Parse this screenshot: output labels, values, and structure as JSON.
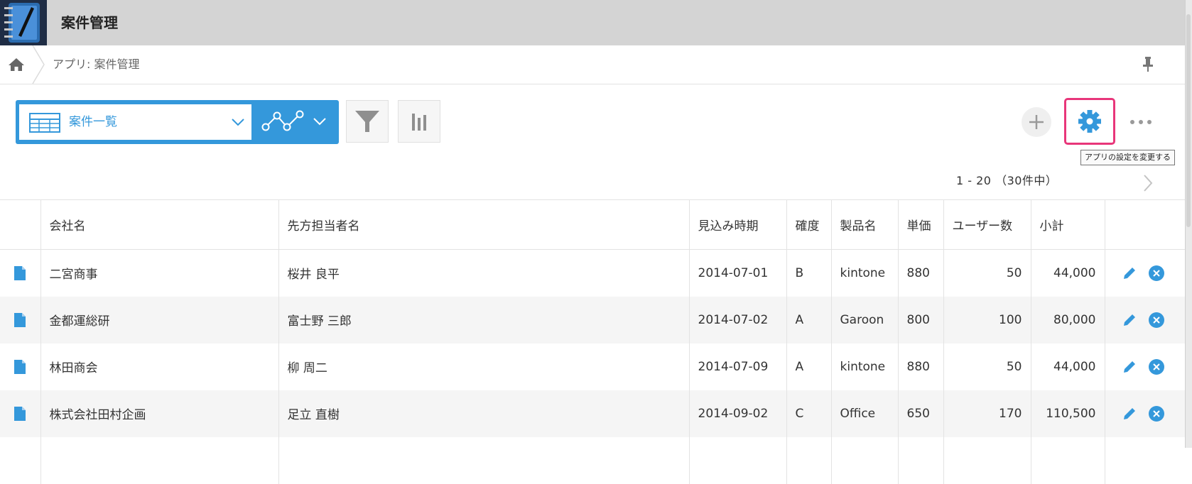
{
  "app": {
    "title": "案件管理"
  },
  "breadcrumb": {
    "text": "アプリ: 案件管理"
  },
  "toolbar": {
    "view_label": "案件一覧",
    "tooltip": "アプリの設定を変更する"
  },
  "pagination": {
    "text": "1 - 20 （30件中）"
  },
  "colors": {
    "accent": "#3498db",
    "highlight": "#e8367a",
    "header_bg": "#d4d4d4"
  },
  "icons": [
    "home-icon",
    "pin-icon",
    "table-view-icon",
    "chevron-down-icon",
    "graph-icon",
    "filter-icon",
    "bar-chart-icon",
    "plus-icon",
    "gear-icon",
    "more-icon",
    "chevron-right-icon",
    "document-icon",
    "pencil-icon",
    "delete-icon"
  ],
  "table": {
    "headers": [
      "会社名",
      "先方担当者名",
      "見込み時期",
      "確度",
      "製品名",
      "単価",
      "ユーザー数",
      "小計"
    ],
    "rows": [
      {
        "company": "二宮商事",
        "contact": "桜井 良平",
        "date": "2014-07-01",
        "certainty": "B",
        "product": "kintone",
        "price": "880",
        "users": "50",
        "subtotal": "44,000"
      },
      {
        "company": "金都運総研",
        "contact": "富士野 三郎",
        "date": "2014-07-02",
        "certainty": "A",
        "product": "Garoon",
        "price": "800",
        "users": "100",
        "subtotal": "80,000"
      },
      {
        "company": "林田商会",
        "contact": "柳 周二",
        "date": "2014-07-09",
        "certainty": "A",
        "product": "kintone",
        "price": "880",
        "users": "50",
        "subtotal": "44,000"
      },
      {
        "company": "株式会社田村企画",
        "contact": "足立 直樹",
        "date": "2014-09-02",
        "certainty": "C",
        "product": "Office",
        "price": "650",
        "users": "170",
        "subtotal": "110,500"
      }
    ]
  }
}
